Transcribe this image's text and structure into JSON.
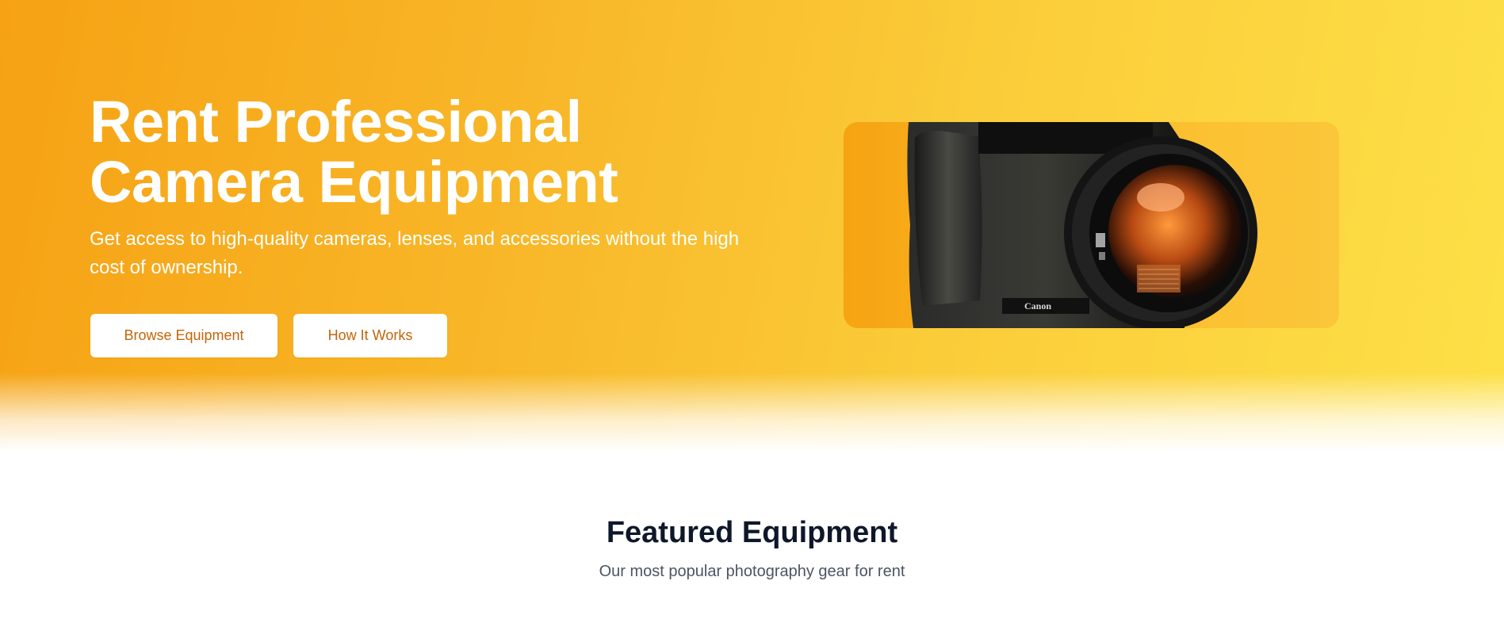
{
  "hero": {
    "title_line1": "Rent Professional",
    "title_line2": "Camera Equipment",
    "subtitle": "Get access to high-quality cameras, lenses, and accessories without the high cost of ownership.",
    "primary_button_label": "Browse Equipment",
    "secondary_button_label": "How It Works",
    "image": {
      "subject": "dslr-camera-photo",
      "brand_text": "Canon"
    }
  },
  "featured": {
    "title": "Featured Equipment",
    "subtitle": "Our most popular photography gear for rent"
  },
  "colors": {
    "hero_gradient_start": "#f6a214",
    "hero_gradient_end": "#fde047",
    "button_text": "#c2650a",
    "heading_dark": "#0f172a",
    "subtext_gray": "#4b5563"
  }
}
